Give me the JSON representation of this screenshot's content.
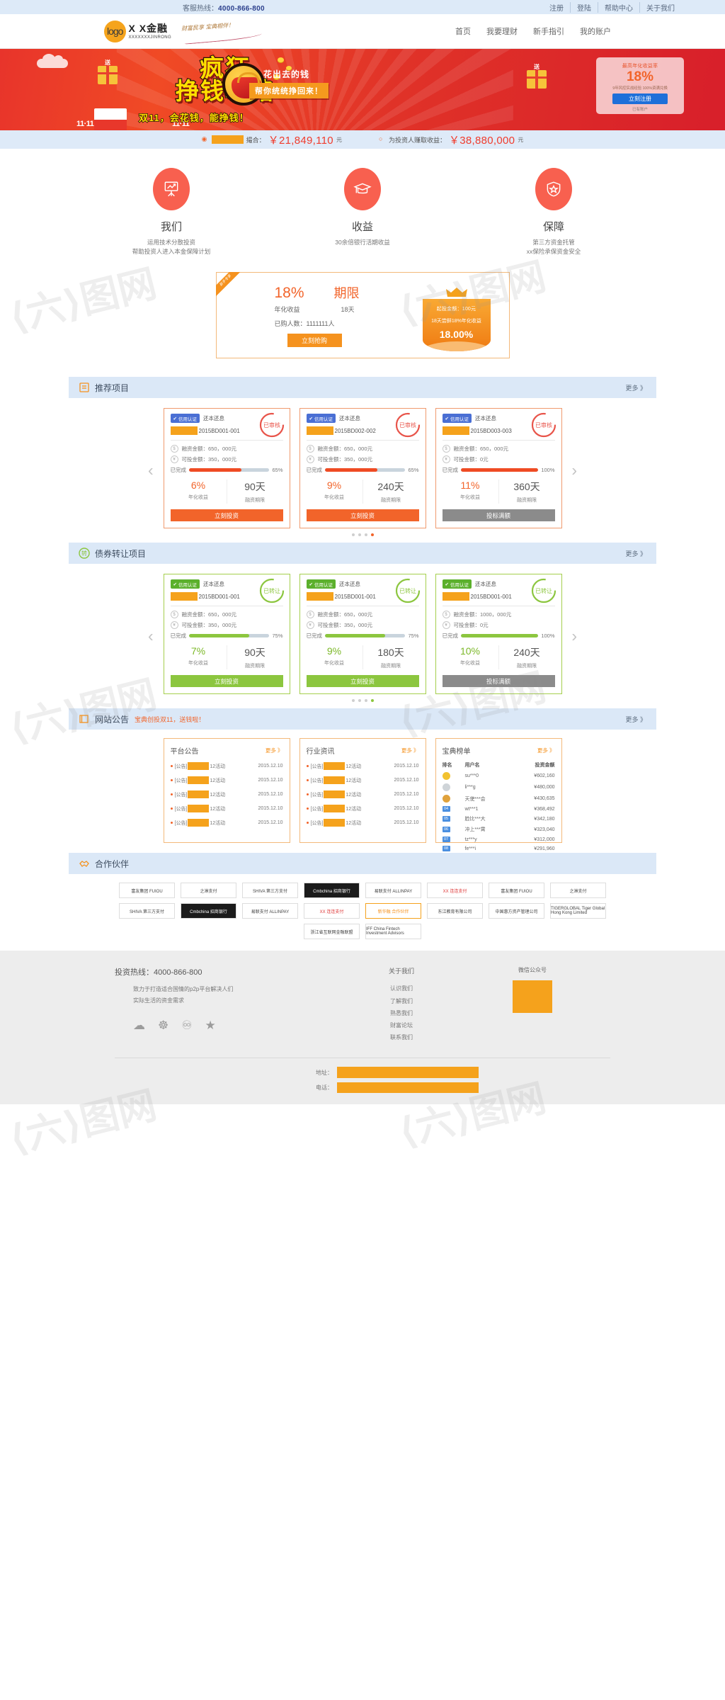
{
  "topbar": {
    "hotline_label": "客服热线：",
    "hotline": "4000-866-800",
    "links": [
      "注册",
      "登陆",
      "帮助中心",
      "关于我们"
    ]
  },
  "header": {
    "logo_text": "logo",
    "brand": "X X金融",
    "brand_en": "XXXXXXXJINRONG",
    "slogan": "财富民享 宝典相伴！",
    "nav": [
      "首页",
      "我要理财",
      "新手指引",
      "我的账户"
    ]
  },
  "banner": {
    "title_line1": "疯狂",
    "title_line2": "挣钱攻略",
    "sub1": "花出去的钱",
    "sub2": "帮你统统挣回来！",
    "bottom_text": "双11，会花钱，能挣钱！",
    "left_badge": "送",
    "right_badge": "送",
    "day_left": "11·11",
    "day_right": "11·11",
    "register_card": {
      "rate_label": "最高年化收益率",
      "rate_value": "18%",
      "desc": "9年风控实战经验  100%资满兑换",
      "button": "立刻注册",
      "footer": "已有账户 "
    }
  },
  "stats": [
    {
      "icon": "coins-icon",
      "label_masked": true,
      "label_suffix": "撮合：",
      "amount": "￥21,849,110",
      "unit": "元"
    },
    {
      "icon": "chat-icon",
      "label_masked": false,
      "label_suffix": "为投资人赚取收益：",
      "amount": "￥38,880,000",
      "unit": "元"
    }
  ],
  "features": [
    {
      "icon": "chart-board-icon",
      "title": "我们",
      "desc_line1": "运用技术分散投资",
      "desc_line2": "帮助投资人进入本金保障计划"
    },
    {
      "icon": "graduation-cap-icon",
      "title": "收益",
      "desc_line1": "30余倍银行活期收益",
      "desc_line2": ""
    },
    {
      "icon": "shield-star-icon",
      "title": "保障",
      "desc_line1": "第三方资金托管",
      "desc_line2": "xx保险承保资金安全"
    }
  ],
  "promo": {
    "ribbon": "新手专享",
    "rate": "18%",
    "rate_label": "年化收益",
    "term_title": "期限",
    "term_value": "18天",
    "buyers": "已购人数：1111111人",
    "button": "立刻抢购",
    "box": {
      "min_amount": "起投金额：100元",
      "desc": "18天尝鲜18%年化收益",
      "rate": "18.00%"
    }
  },
  "recommend": {
    "head": {
      "icon": "list-icon",
      "title": "推荐项目",
      "more": "更多 》"
    },
    "cards": [
      {
        "badge": "信用认证",
        "type": "还本还息",
        "stamp": "已审核",
        "id": "2015BD001-001",
        "finance_label": "融资金额：650，000元",
        "invest_label": "可投金额：350，000元",
        "progress_label": "已完成",
        "progress": 65,
        "progress_text": "65%",
        "rate": "6%",
        "rate_label": "年化收益",
        "term": "90天",
        "term_label": "融资期限",
        "button": "立刻投资",
        "button_state": "active"
      },
      {
        "badge": "信用认证",
        "type": "还本还息",
        "stamp": "已审核",
        "id": "2015BD002-002",
        "finance_label": "融资金额：650，000元",
        "invest_label": "可投金额：350，000元",
        "progress_label": "已完成",
        "progress": 65,
        "progress_text": "65%",
        "rate": "9%",
        "rate_label": "年化收益",
        "term": "240天",
        "term_label": "融资期限",
        "button": "立刻投资",
        "button_state": "active"
      },
      {
        "badge": "信用认证",
        "type": "还本还息",
        "stamp": "已审核",
        "id": "2015BD003-003",
        "finance_label": "融资金额：650，000元",
        "invest_label": "可投金额：0元",
        "progress_label": "已完成",
        "progress": 100,
        "progress_text": "100%",
        "rate": "11%",
        "rate_label": "年化收益",
        "term": "360天",
        "term_label": "融资期限",
        "button": "投标满额",
        "button_state": "disabled"
      }
    ],
    "dots": [
      false,
      false,
      false,
      true
    ]
  },
  "transfer": {
    "head": {
      "icon": "transfer-icon",
      "icon_text": "转",
      "title": "债券转让项目",
      "more": "更多 》"
    },
    "cards": [
      {
        "badge": "信用认证",
        "type": "还本还息",
        "stamp": "已转让",
        "id": "2015BD001-001",
        "finance_label": "融资金额：650，000元",
        "invest_label": "可投金额：350，000元",
        "progress_label": "已完成",
        "progress": 75,
        "progress_text": "75%",
        "rate": "7%",
        "rate_label": "年化收益",
        "term": "90天",
        "term_label": "融资期限",
        "button": "立刻投资",
        "button_state": "active"
      },
      {
        "badge": "信用认证",
        "type": "还本还息",
        "stamp": "已转让",
        "id": "2015BD001-001",
        "finance_label": "融资金额：650，000元",
        "invest_label": "可投金额：350，000元",
        "progress_label": "已完成",
        "progress": 75,
        "progress_text": "75%",
        "rate": "9%",
        "rate_label": "年化收益",
        "term": "180天",
        "term_label": "融资期限",
        "button": "立刻投资",
        "button_state": "active"
      },
      {
        "badge": "信用认证",
        "type": "还本还息",
        "stamp": "已转让",
        "id": "2015BD001-001",
        "finance_label": "融资金额：1000，000元",
        "invest_label": "可投金额：0元",
        "progress_label": "已完成",
        "progress": 100,
        "progress_text": "100%",
        "rate": "10%",
        "rate_label": "年化收益",
        "term": "240天",
        "term_label": "融资期限",
        "button": "投标满额",
        "button_state": "disabled"
      }
    ],
    "dots": [
      false,
      false,
      false,
      true
    ]
  },
  "notice": {
    "head": {
      "icon": "announce-icon",
      "title": "网站公告",
      "sub": "宝典创投双11，送钱啦！",
      "more": "更多 》"
    },
    "panel1": {
      "title": "平台公告",
      "more": "更多 》",
      "rows": [
        {
          "tag": "[公告]",
          "masked": true,
          "text": "12活动",
          "date": "2015.12.10"
        },
        {
          "tag": "[公告]",
          "masked": true,
          "text": "12活动",
          "date": "2015.12.10"
        },
        {
          "tag": "[公告]",
          "masked": true,
          "text": "12活动",
          "date": "2015.12.10"
        },
        {
          "tag": "[公告]",
          "masked": true,
          "text": "12活动",
          "date": "2015.12.10"
        },
        {
          "tag": "[公告]",
          "masked": true,
          "text": "12活动",
          "date": "2015.12.10"
        }
      ]
    },
    "panel2": {
      "title": "行业资讯",
      "more": "更多 》",
      "rows": [
        {
          "tag": "[公告]",
          "masked": true,
          "text": "12活动",
          "date": "2015.12.10"
        },
        {
          "tag": "[公告]",
          "masked": true,
          "text": "12活动",
          "date": "2015.12.10"
        },
        {
          "tag": "[公告]",
          "masked": true,
          "text": "12活动",
          "date": "2015.12.10"
        },
        {
          "tag": "[公告]",
          "masked": true,
          "text": "12活动",
          "date": "2015.12.10"
        },
        {
          "tag": "[公告]",
          "masked": true,
          "text": "12活动",
          "date": "2015.12.10"
        }
      ]
    },
    "panel3": {
      "title": "宝典榜单",
      "more": "更多 》",
      "columns": [
        "排名",
        "用户名",
        "投资金额"
      ],
      "rows": [
        {
          "rank": "1",
          "rank_type": "gold",
          "user": "su***0",
          "amount": "¥602,160"
        },
        {
          "rank": "2",
          "rank_type": "silver",
          "user": "li***g",
          "amount": "¥480,000"
        },
        {
          "rank": "3",
          "rank_type": "bronze",
          "user": "天使***会",
          "amount": "¥430,635"
        },
        {
          "rank": "04",
          "rank_type": "num",
          "user": "wt***1",
          "amount": "¥368,492"
        },
        {
          "rank": "05",
          "rank_type": "num",
          "user": "脸比***大",
          "amount": "¥342,180"
        },
        {
          "rank": "06",
          "rank_type": "num",
          "user": "冲上***霄",
          "amount": "¥323,040"
        },
        {
          "rank": "07",
          "rank_type": "num",
          "user": "tz***y",
          "amount": "¥312,000"
        },
        {
          "rank": "08",
          "rank_type": "num",
          "user": "fe***i",
          "amount": "¥291,960"
        }
      ]
    }
  },
  "partners": {
    "head": {
      "icon": "handshake-icon",
      "title": "合作伙伴"
    },
    "logos": [
      {
        "name": "富友集团 FUIOU",
        "style": "fuiou"
      },
      {
        "name": "之淋支付",
        "style": "plain"
      },
      {
        "name": "SHIVA 第三方支付",
        "style": "shiva"
      },
      {
        "name": "Cmbchina 招商银行",
        "style": "cmb"
      },
      {
        "name": "易联支付 ALLINPAY",
        "style": "allin"
      },
      {
        "name": "XX 连连支付",
        "style": "lianlian"
      },
      {
        "name": "富友集团 FUIOU",
        "style": "fuiou"
      },
      {
        "name": "之淋支付",
        "style": "plain"
      },
      {
        "name": "SHIVA 第三方支付",
        "style": "shiva"
      },
      {
        "name": "Cmbchina 招商银行",
        "style": "cmb"
      },
      {
        "name": "易联支付 ALLINPAY",
        "style": "allin"
      },
      {
        "name": "XX 连连支付",
        "style": "lianlian"
      },
      {
        "name": "新华融 合作伙伴",
        "style": "orange"
      },
      {
        "name": "东江教育有限公司",
        "style": "plain"
      },
      {
        "name": "中国惠方资产管理公司",
        "style": "plain"
      },
      {
        "name": "TIGERGLOBAL Tiger Global Hong Kong Limited",
        "style": "tiger"
      },
      {
        "name": "浙江省互联网金融联盟",
        "style": "plain"
      },
      {
        "name": "IFF China Fintech Investment Advisors",
        "style": "iff"
      }
    ]
  },
  "footer": {
    "hotline": "投资热线：4000-866-800",
    "desc_line1": "致力于打造适合国情的p2p平台解决人们",
    "desc_line2": "实际生活的资金需求",
    "social": [
      "wechat-icon",
      "weibo-icon",
      "qq-icon",
      "star-icon"
    ],
    "about_title": "关于我们",
    "about_links": [
      "认识我们",
      "了解我们",
      "熟悉我们",
      "财富论坛",
      "联系我们"
    ],
    "qr_title": "微信公众号",
    "address_label": "地址：",
    "phone_label": "电话："
  },
  "colors": {
    "orange": "#f2642a",
    "orange_light": "#f5a21c",
    "blue_bar": "#deeaf8",
    "green": "#8cc63f",
    "red_banner": "#e8342b"
  }
}
